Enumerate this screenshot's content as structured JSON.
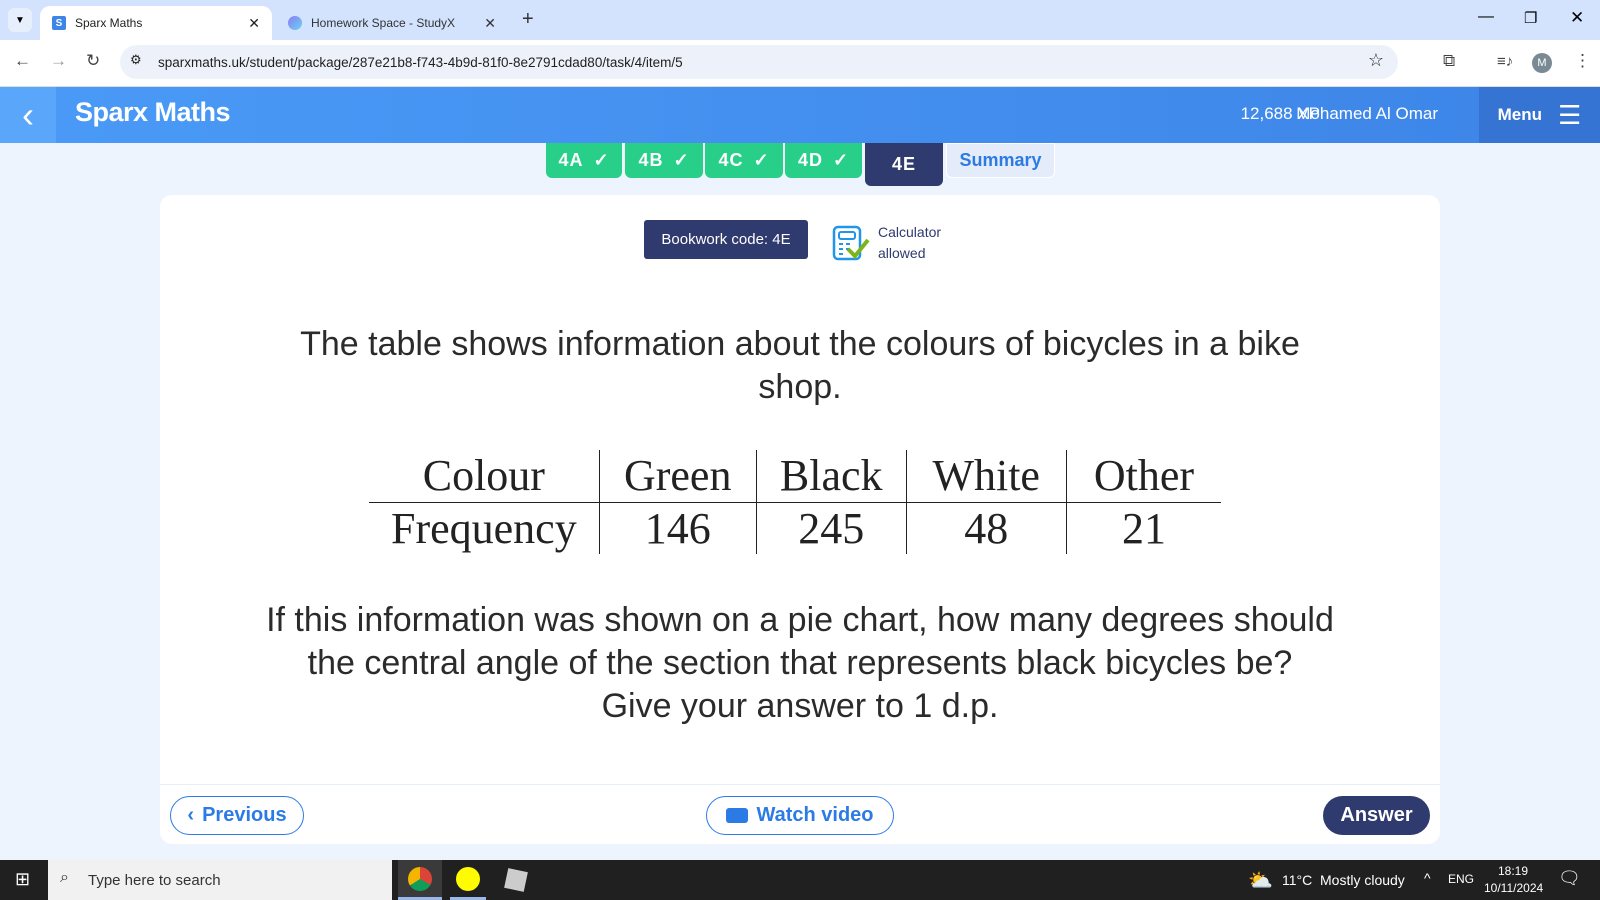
{
  "browser": {
    "tabs": [
      {
        "title": "Sparx Maths",
        "favicon": "S"
      },
      {
        "title": "Homework Space - StudyX"
      }
    ],
    "url": "sparxmaths.uk/student/package/287e21b8-f743-4b9d-81f0-8e2791cdad80/task/4/item/5",
    "profile_initial": "M"
  },
  "header": {
    "brand": "Sparx Maths",
    "xp": "12,688 XP",
    "user": "Mohamed Al Omar",
    "menu": "Menu"
  },
  "task_tabs": [
    {
      "label": "4A",
      "done": true
    },
    {
      "label": "4B",
      "done": true
    },
    {
      "label": "4C",
      "done": true
    },
    {
      "label": "4D",
      "done": true
    },
    {
      "label": "4E",
      "active": true
    },
    {
      "label": "Summary"
    }
  ],
  "question": {
    "bookwork": "Bookwork code: 4E",
    "calculator_line1": "Calculator",
    "calculator_line2": "allowed",
    "intro_line1": "The table shows information about the colours of bicycles in a bike",
    "intro_line2": "shop.",
    "table": {
      "headers": [
        "Colour",
        "Green",
        "Black",
        "White",
        "Other"
      ],
      "row": [
        "Frequency",
        "146",
        "245",
        "48",
        "21"
      ]
    },
    "prompt_line1": "If this information was shown on a pie chart, how many degrees should",
    "prompt_line2": "the central angle of the section that represents black bicycles be?",
    "prompt_line3": "Give your answer to 1 d.p."
  },
  "buttons": {
    "previous": "Previous",
    "watch": "Watch video",
    "answer": "Answer"
  },
  "taskbar": {
    "search_placeholder": "Type here to search",
    "temp": "11°C",
    "weather": "Mostly cloudy",
    "lang": "ENG",
    "time": "18:19",
    "date": "10/11/2024"
  },
  "colors": {
    "accent": "#3d85e8",
    "done": "#28cf89",
    "navy": "#2f3a6e"
  }
}
